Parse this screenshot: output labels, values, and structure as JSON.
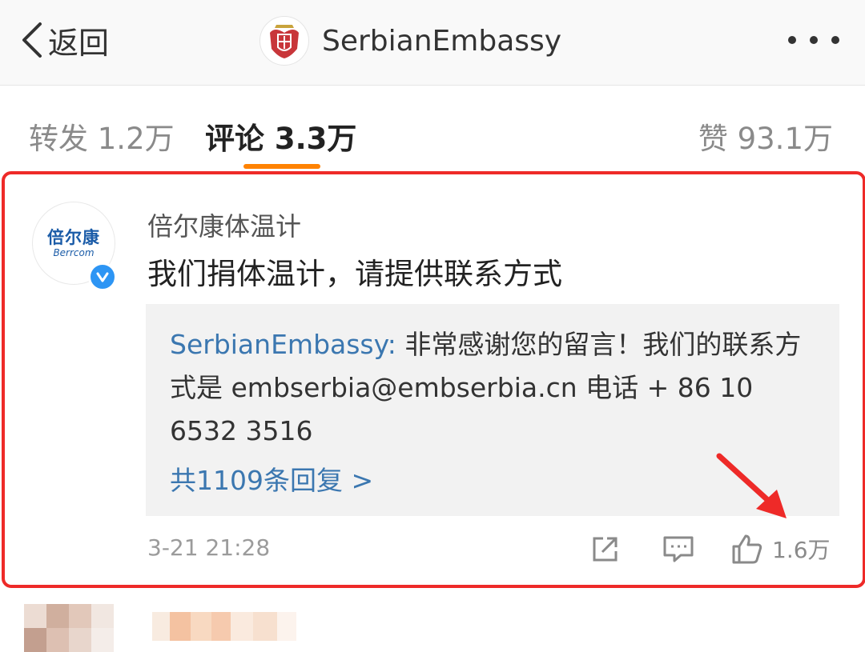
{
  "nav": {
    "back_label": "返回",
    "title": "SerbianEmbassy"
  },
  "tabs": {
    "forward": "转发 1.2万",
    "comments": "评论 3.3万",
    "likes": "赞 93.1万",
    "active": "comments"
  },
  "comment": {
    "author": "倍尔康体温计",
    "avatar_text_zh": "倍尔康",
    "avatar_text_en": "Berrcom",
    "verified": true,
    "text": "我们捐体温计，请提供联系方式",
    "reply": {
      "author": "SerbianEmbassy:",
      "text": " 非常感谢您的留言！我们的联系方式是 embserbia@embserbia.cn 电话 + 86 10 6532 3516"
    },
    "reply_count_label": "共1109条回复 >",
    "timestamp": "3-21 21:28",
    "like_count": "1.6万"
  },
  "colors": {
    "accent_orange": "#ff8200",
    "highlight_red": "#ee2a28",
    "link_blue": "#3b77b0",
    "verified_blue": "#2d95f4"
  },
  "icons": [
    "back-chevron-icon",
    "serbian-emblem-icon",
    "more-icon",
    "verified-icon",
    "share-icon",
    "reply-icon",
    "like-icon",
    "arrow-annotation"
  ]
}
